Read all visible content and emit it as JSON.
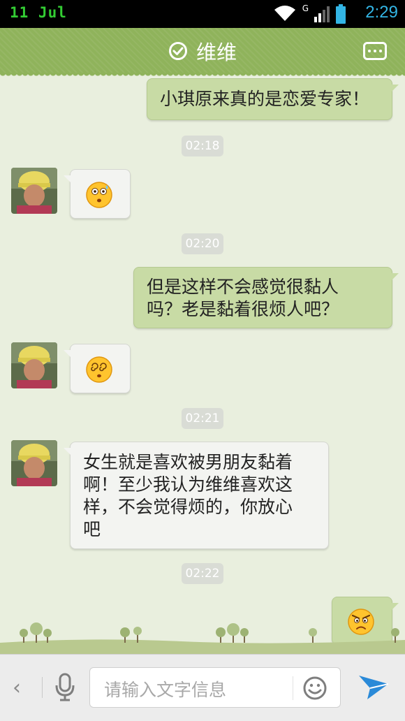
{
  "status_bar": {
    "left_text": "11  Jul",
    "time": "2:29",
    "signal_label": "G"
  },
  "header": {
    "title": "维维"
  },
  "messages": [
    {
      "side": "right",
      "text": "小琪原来真的是恋爱专家！"
    },
    {
      "side": "time",
      "text": "02:18"
    },
    {
      "side": "left",
      "emoji": "dazed-face-emoji"
    },
    {
      "side": "time",
      "text": "02:20"
    },
    {
      "side": "right",
      "text_line1": "但是这样不会感觉很黏人",
      "text_line2": "吗？老是黏着很烦人吧？"
    },
    {
      "side": "left",
      "emoji": "dizzy-face-emoji"
    },
    {
      "side": "time",
      "text": "02:21"
    },
    {
      "side": "left",
      "text_line1": "女生就是喜欢被男朋友黏着",
      "text_line2": "啊！至少我认为维维喜欢这",
      "text_line3": "样，不会觉得烦的，你放心",
      "text_line4": "吧"
    },
    {
      "side": "time",
      "text": "02:22"
    },
    {
      "side": "right",
      "emoji": "angry-face-emoji"
    }
  ],
  "input_bar": {
    "placeholder": "请输入文字信息"
  },
  "colors": {
    "header_green": "#8fb35b",
    "chat_bg": "#e9efde",
    "sent_bubble": "#c8dba5",
    "received_bubble": "#f3f4f1",
    "status_time_blue": "#33b5e5",
    "status_date_green": "#33cc33",
    "send_blue": "#2a8ad8"
  }
}
